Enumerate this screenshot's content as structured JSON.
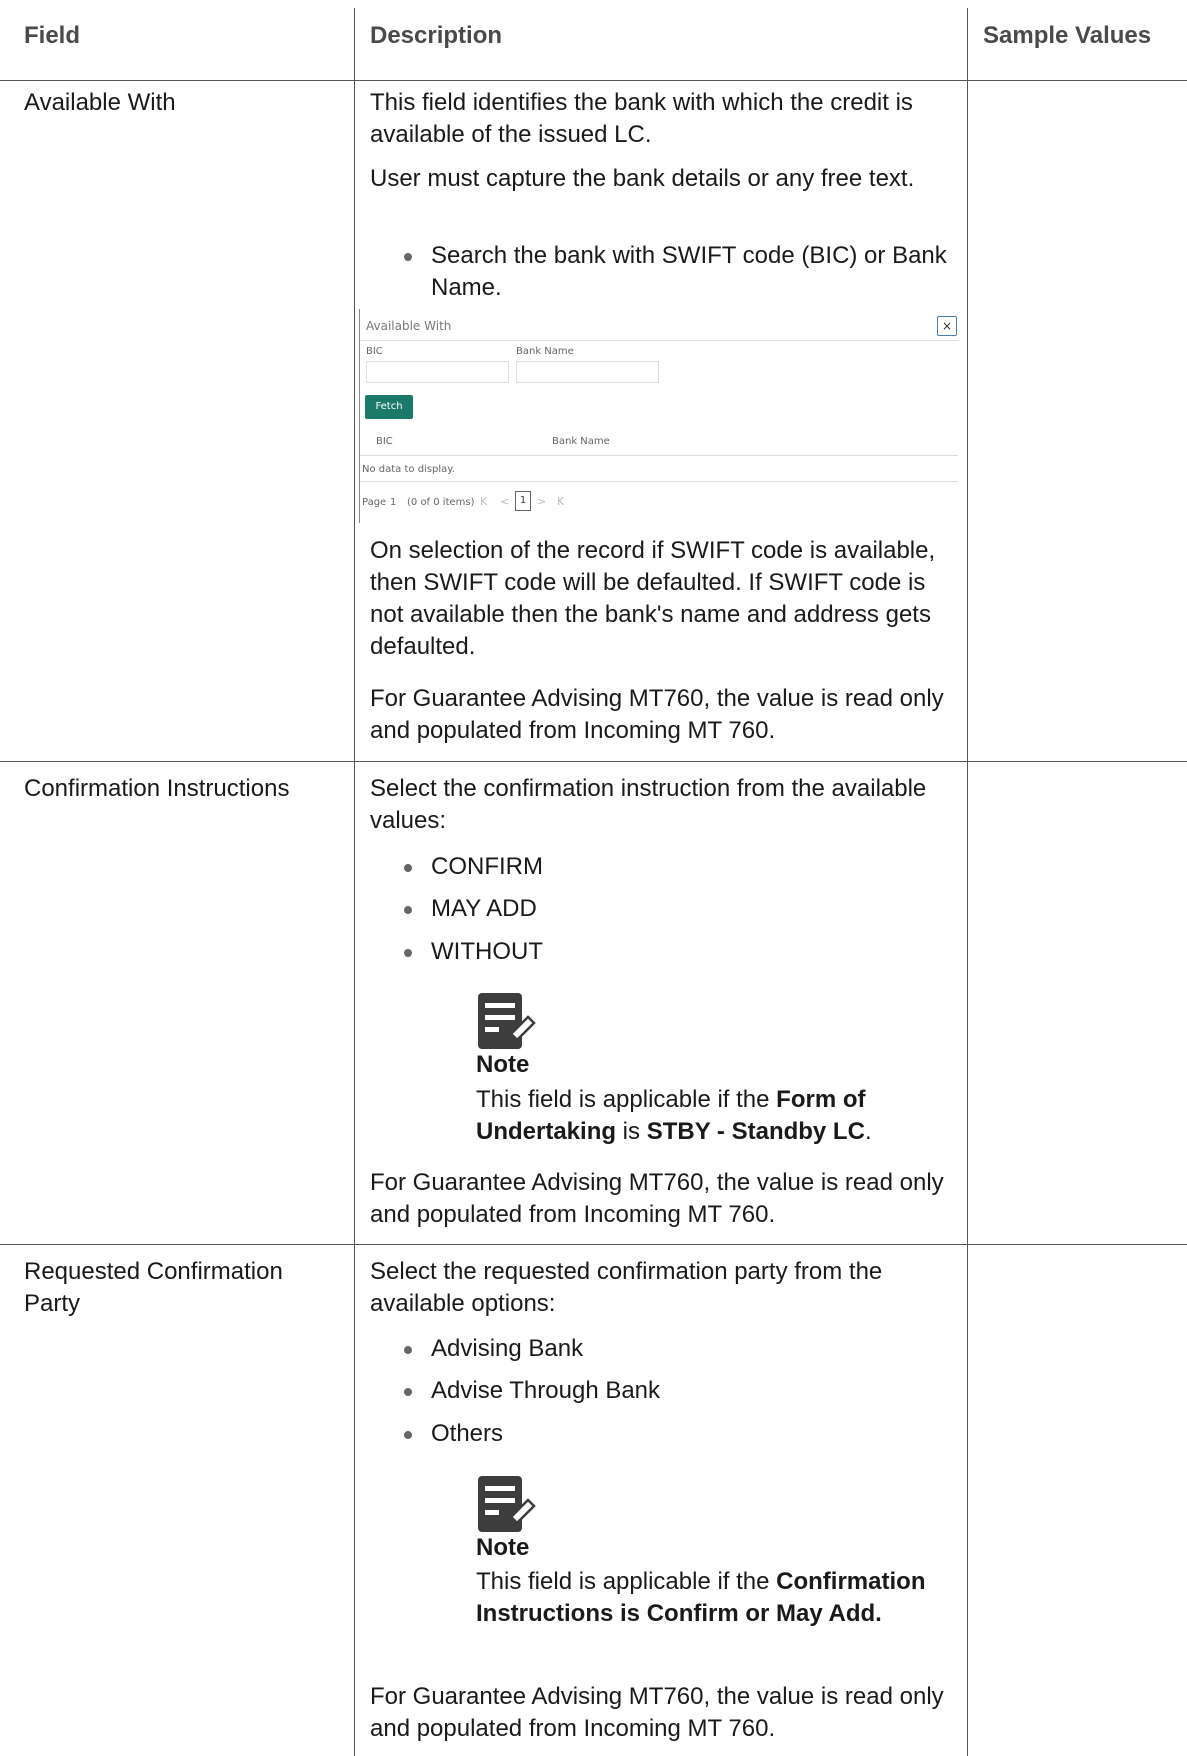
{
  "header": {
    "field": "Field",
    "description": "Description",
    "sample_values": "Sample Values"
  },
  "rows": [
    {
      "field": "Available With",
      "desc1": "This field identifies the bank with which the credit is available of the issued LC.",
      "desc2": "User must capture the bank details or any free text.",
      "bullet": "Search the bank with SWIFT code (BIC) or Bank Name.",
      "desc3": "On selection of the record if SWIFT code is available, then SWIFT code will be defaulted. If SWIFT code is not available then the bank's name and address gets defaulted.",
      "desc4": "For Guarantee Advising MT760, the value is read only and populated from Incoming MT 760."
    },
    {
      "field": "Confirmation Instructions",
      "desc1": "Select the confirmation instruction from the available values:",
      "bullets": [
        "CONFIRM",
        "MAY ADD",
        "WITHOUT"
      ],
      "note_label": "Note",
      "note_pre": "This field is applicable if the ",
      "note_b1": "Form of Undertaking",
      "note_mid": " is ",
      "note_b2": "STBY - Standby LC",
      "note_post": ".",
      "desc2": "For Guarantee Advising MT760, the value is read only and populated from Incoming MT 760."
    },
    {
      "field": "Requested Confirmation Party",
      "desc1": "Select the requested confirmation party from the available options:",
      "bullets": [
        "Advising Bank",
        "Advise Through Bank",
        "Others"
      ],
      "note_label": "Note",
      "note_pre": "This field is applicable if the ",
      "note_b1": "Confirmation Instructions is Confirm or May Add.",
      "desc2": "For Guarantee Advising MT760, the value is read only and populated from Incoming MT 760."
    }
  ],
  "dialog": {
    "title": "Available With",
    "close": "×",
    "bic_label": "BIC",
    "bank_name_label": "Bank Name",
    "fetch": "Fetch",
    "col_bic": "BIC",
    "col_bank_name": "Bank Name",
    "empty": "No data to display.",
    "page_label": "Page",
    "page_value": "1",
    "items": "(0 of 0 items)",
    "first": "K",
    "prev": "<",
    "current_page": "1",
    "next": ">",
    "last": "K"
  },
  "icon_name": "note-icon"
}
